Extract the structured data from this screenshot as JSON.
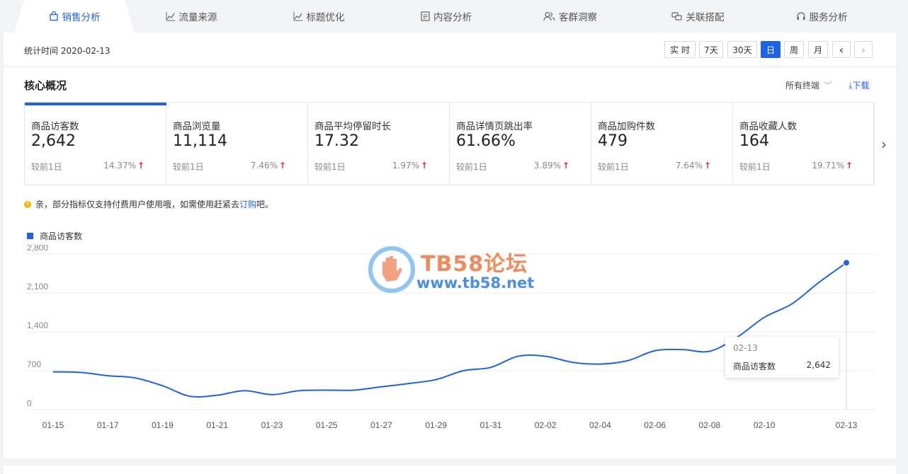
{
  "tabs": [
    {
      "label": "销售分析",
      "icon": "bag-icon",
      "active": true
    },
    {
      "label": "流量来源",
      "icon": "trend-icon",
      "active": false
    },
    {
      "label": "标题优化",
      "icon": "trend-icon",
      "active": false
    },
    {
      "label": "内容分析",
      "icon": "document-icon",
      "active": false
    },
    {
      "label": "客群洞察",
      "icon": "users-icon",
      "active": false
    },
    {
      "label": "关联搭配",
      "icon": "link-icon",
      "active": false
    },
    {
      "label": "服务分析",
      "icon": "headset-icon",
      "active": false
    }
  ],
  "datebar": {
    "stat_time": "统计时间 2020-02-13",
    "buttons": [
      "实 时",
      "7天",
      "30天",
      "日",
      "周",
      "月"
    ],
    "selected": "日",
    "prev_icon": "‹",
    "next_icon": "›"
  },
  "overview": {
    "title": "核心概况",
    "terminal": "所有终端",
    "download": "下载"
  },
  "cards": [
    {
      "title": "商品访客数",
      "value": "2,642",
      "compare": "较前1日",
      "pct": "14.37%",
      "trend": "up"
    },
    {
      "title": "商品浏览量",
      "value": "11,114",
      "compare": "较前1日",
      "pct": "7.46%",
      "trend": "up"
    },
    {
      "title": "商品平均停留时长",
      "value": "17.32",
      "compare": "较前1日",
      "pct": "1.97%",
      "trend": "up"
    },
    {
      "title": "商品详情页跳出率",
      "value": "61.66%",
      "compare": "较前1日",
      "pct": "3.89%",
      "trend": "up"
    },
    {
      "title": "商品加购件数",
      "value": "479",
      "compare": "较前1日",
      "pct": "7.64%",
      "trend": "up"
    },
    {
      "title": "商品收藏人数",
      "value": "164",
      "compare": "较前1日",
      "pct": "19.71%",
      "trend": "up"
    }
  ],
  "notice": {
    "text": "亲，部分指标仅支持付费用户使用哦，如需使用赶紧去",
    "link": "订购",
    "suffix": "吧。"
  },
  "watermark": {
    "line1": "TB58论坛",
    "line2": "www.tb58.net"
  },
  "tooltip": {
    "date": "02-13",
    "name": "商品访客数",
    "value": "2,642"
  },
  "colors": {
    "accent": "#2062e6",
    "up": "#e5322d"
  },
  "chart_data": {
    "type": "line",
    "legend": "商品访客数",
    "ylim": [
      0,
      2800
    ],
    "yticks": [
      "0",
      "700",
      "1,400",
      "2,100",
      "2,800"
    ],
    "xtick_labels": [
      "01-15",
      "01-17",
      "01-19",
      "01-21",
      "01-23",
      "01-25",
      "01-27",
      "01-29",
      "01-31",
      "02-02",
      "02-04",
      "02-06",
      "02-08",
      "02-10",
      "02-13"
    ],
    "x": [
      "01-15",
      "01-16",
      "01-17",
      "01-18",
      "01-19",
      "01-20",
      "01-21",
      "01-22",
      "01-23",
      "01-24",
      "01-25",
      "01-26",
      "01-27",
      "01-28",
      "01-29",
      "01-30",
      "01-31",
      "02-01",
      "02-02",
      "02-03",
      "02-04",
      "02-05",
      "02-06",
      "02-07",
      "02-08",
      "02-09",
      "02-10",
      "02-11",
      "02-12",
      "02-13"
    ],
    "series": [
      {
        "name": "商品访客数",
        "values": [
          680,
          670,
          610,
          570,
          430,
          240,
          260,
          340,
          270,
          340,
          350,
          350,
          410,
          470,
          540,
          700,
          760,
          960,
          960,
          850,
          820,
          880,
          1060,
          1080,
          1050,
          1300,
          1660,
          1900,
          2290,
          2642
        ]
      }
    ],
    "grid": true
  }
}
